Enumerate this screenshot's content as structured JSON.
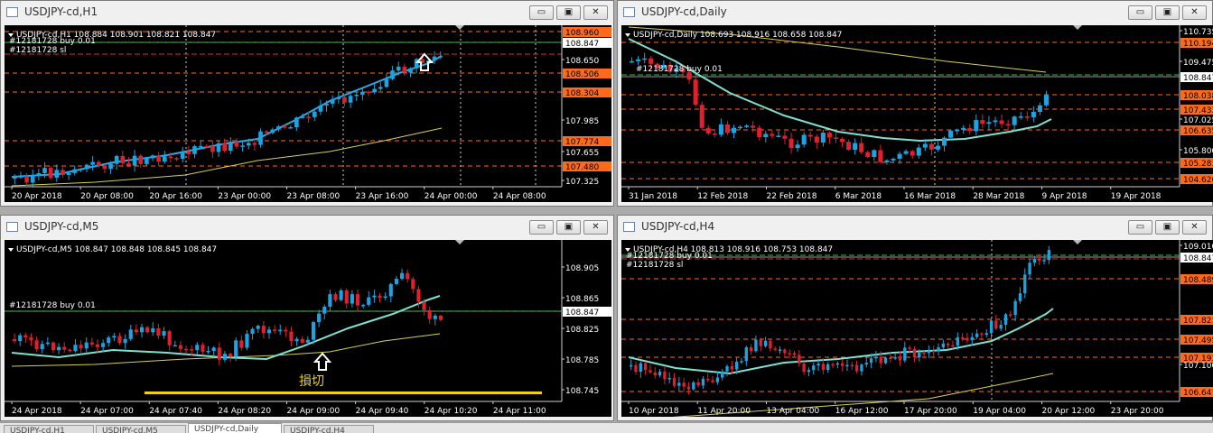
{
  "windows": [
    {
      "id": "h1",
      "title": "USDJPY-cd,H1",
      "header": "USDJPY-cd,H1  108.884 108.901 108.821 108.847",
      "labels": [
        "#12181728 buy 0.01",
        "#12181728 sl"
      ],
      "price_labels": [
        {
          "text": "108.960",
          "tag": "orange"
        },
        {
          "text": "108.847",
          "tag": "white"
        },
        {
          "text": "108.650",
          "tag": "none"
        },
        {
          "text": "108.506",
          "tag": "orange"
        },
        {
          "text": "108.304",
          "tag": "orange"
        },
        {
          "text": "107.985",
          "tag": "none"
        },
        {
          "text": "107.774",
          "tag": "orange"
        },
        {
          "text": "107.655",
          "tag": "none"
        },
        {
          "text": "107.480",
          "tag": "orange"
        },
        {
          "text": "107.325",
          "tag": "none"
        }
      ],
      "time_labels": [
        "20 Apr 2018",
        "20 Apr 08:00",
        "20 Apr 16:00",
        "23 Apr 00:00",
        "23 Apr 08:00",
        "23 Apr 16:00",
        "24 Apr 00:00",
        "24 Apr 08:00"
      ]
    },
    {
      "id": "daily",
      "title": "USDJPY-cd,Daily",
      "header": "USDJPY-cd,Daily  108.693 108.916 108.658 108.847",
      "labels": [
        "#12181728 buy 0.01"
      ],
      "price_labels": [
        {
          "text": "110.735",
          "tag": "none"
        },
        {
          "text": "110.194",
          "tag": "orange"
        },
        {
          "text": "109.475",
          "tag": "none"
        },
        {
          "text": "108.847",
          "tag": "white"
        },
        {
          "text": "108.038",
          "tag": "orange"
        },
        {
          "text": "107.433",
          "tag": "orange"
        },
        {
          "text": "107.025",
          "tag": "none"
        },
        {
          "text": "106.635",
          "tag": "orange"
        },
        {
          "text": "105.800",
          "tag": "none"
        },
        {
          "text": "105.283",
          "tag": "orange"
        },
        {
          "text": "104.626",
          "tag": "orange"
        }
      ],
      "time_labels": [
        "31 Jan 2018",
        "12 Feb 2018",
        "22 Feb 2018",
        "6 Mar 2018",
        "16 Mar 2018",
        "28 Mar 2018",
        "9 Apr 2018",
        "19 Apr 2018"
      ]
    },
    {
      "id": "m5",
      "title": "USDJPY-cd,M5",
      "header": "USDJPY-cd,M5  108.847 108.848 108.845 108.847",
      "labels": [
        "#12181728 buy 0.01"
      ],
      "annotation": "損切",
      "price_labels": [
        {
          "text": "108.905",
          "tag": "none"
        },
        {
          "text": "108.865",
          "tag": "none"
        },
        {
          "text": "108.847",
          "tag": "white"
        },
        {
          "text": "108.825",
          "tag": "none"
        },
        {
          "text": "108.785",
          "tag": "none"
        },
        {
          "text": "108.745",
          "tag": "none"
        }
      ],
      "time_labels": [
        "24 Apr 2018",
        "24 Apr 07:00",
        "24 Apr 07:40",
        "24 Apr 08:20",
        "24 Apr 09:00",
        "24 Apr 09:40",
        "24 Apr 10:20",
        "24 Apr 11:00"
      ]
    },
    {
      "id": "h4",
      "title": "USDJPY-cd,H4",
      "header": "USDJPY-cd,H4  108.813 108.916 108.753 108.847",
      "labels": [
        "#12181728 buy 0.01",
        "#12181728 sl"
      ],
      "price_labels": [
        {
          "text": "109.010",
          "tag": "none"
        },
        {
          "text": "108.847",
          "tag": "white"
        },
        {
          "text": "108.489",
          "tag": "orange"
        },
        {
          "text": "107.821",
          "tag": "orange"
        },
        {
          "text": "107.495",
          "tag": "orange"
        },
        {
          "text": "107.193",
          "tag": "orange"
        },
        {
          "text": "107.100",
          "tag": "none"
        },
        {
          "text": "106.641",
          "tag": "orange"
        }
      ],
      "time_labels": [
        "10 Apr 2018",
        "11 Apr 20:00",
        "13 Apr 04:00",
        "16 Apr 12:00",
        "17 Apr 20:00",
        "19 Apr 04:00",
        "20 Apr 12:00",
        "23 Apr 20:00"
      ]
    }
  ],
  "window_buttons": {
    "minimize": "▭",
    "restore": "▣",
    "close": "✕"
  },
  "tabs": [
    "USDJPY-cd,H1",
    "USDJPY-cd,M5",
    "USDJPY-cd,Daily",
    "USDJPY-cd,H4"
  ],
  "active_tab": 2,
  "colors": {
    "background": "#000000",
    "bull": "#1fa3e0",
    "bear": "#e0202e",
    "ma_fast_blue": "#29a9e6",
    "ma_fast_cyan": "#7ee0d0",
    "ma_slow": "#d8d050",
    "orange_level": "#ff6a1a",
    "entry_line": "#38c040",
    "axis_text": "#ffffff",
    "stoploss_marker": "#f2d400"
  }
}
